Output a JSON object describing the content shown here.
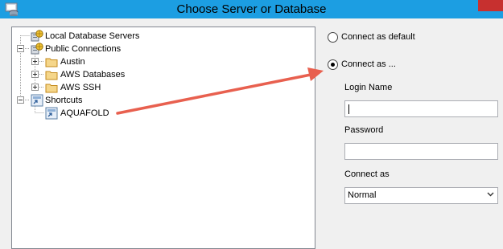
{
  "window": {
    "title": "Choose Server or Database"
  },
  "tree": {
    "local": "Local Database Servers",
    "public": "Public Connections",
    "austin": "Austin",
    "aws_db": "AWS Databases",
    "aws_ssh": "AWS SSH",
    "shortcuts": "Shortcuts",
    "aquafold": "AQUAFOLD"
  },
  "options": {
    "connect_default": "Connect as default",
    "connect_as": "Connect as ...",
    "selected": "Connect as ..."
  },
  "fields": {
    "login_label": "Login Name",
    "login_value": "",
    "password_label": "Password",
    "password_value": "",
    "connect_as_label": "Connect as",
    "connect_as_value": "Normal"
  },
  "colors": {
    "titlebar": "#1c9ee2",
    "close_button": "#c7302f",
    "annotation_arrow": "#e8604f",
    "folder": "#d9a441"
  }
}
